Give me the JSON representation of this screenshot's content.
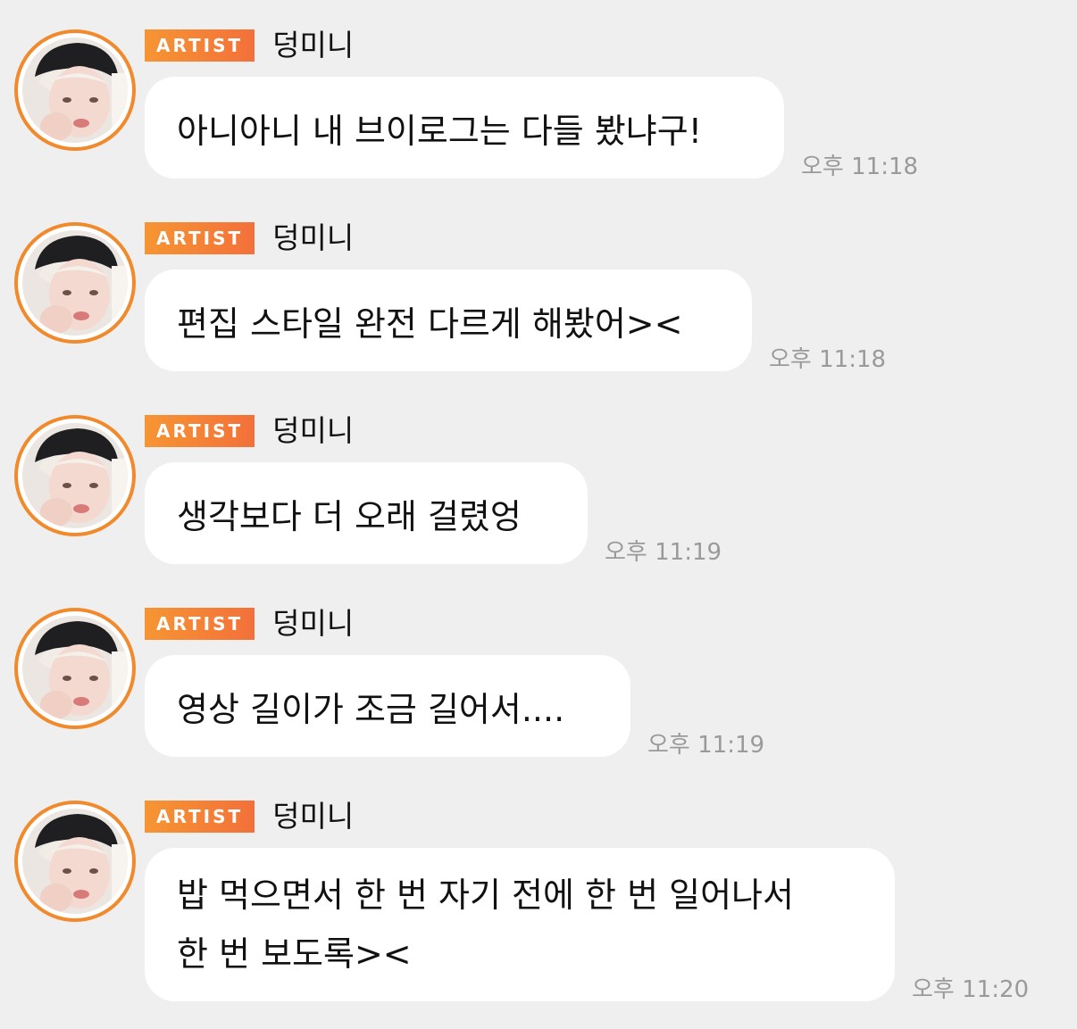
{
  "colors": {
    "background": "#efefef",
    "bubble": "#ffffff",
    "badge_start": "#f69533",
    "badge_end": "#f3703a",
    "avatar_ring": "#f08a2c",
    "time_text": "#9a9a9a"
  },
  "icons": {
    "avatar": "user-avatar-photo"
  },
  "messages": [
    {
      "badge": "ARTIST",
      "sender": "덩미니",
      "text": "아니아니 내 브이로그는 다들 봤냐구!",
      "time": "오후 11:18"
    },
    {
      "badge": "ARTIST",
      "sender": "덩미니",
      "text": "편집 스타일 완전 다르게 해봤어><",
      "time": "오후 11:18"
    },
    {
      "badge": "ARTIST",
      "sender": "덩미니",
      "text": "생각보다 더 오래 걸렸엉",
      "time": "오후 11:19"
    },
    {
      "badge": "ARTIST",
      "sender": "덩미니",
      "text": "영상 길이가 조금 길어서....",
      "time": "오후 11:19"
    },
    {
      "badge": "ARTIST",
      "sender": "덩미니",
      "lines": [
        "밥 먹으면서 한 번 자기 전에 한 번 일어나서",
        "한 번 보도록><"
      ],
      "time": "오후 11:20"
    }
  ]
}
